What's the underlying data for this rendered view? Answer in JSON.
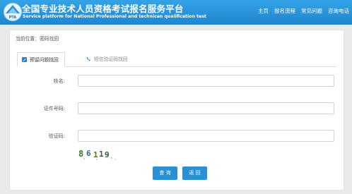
{
  "header": {
    "title": "全国专业技术人员资格考试报名服务平台",
    "subtitle": "Service platform for National Professional and technican qualification test",
    "nav": [
      "主页",
      "报名流程",
      "常见问题",
      "咨询电话"
    ]
  },
  "breadcrumb": "当前位置：密码找回",
  "tabs": [
    "预留问题找回",
    "短信验证码找回"
  ],
  "form": {
    "name_label": "姓名:",
    "id_label": "证件号码:",
    "captcha_label": "验证码:",
    "captcha_text": "86119"
  },
  "buttons": {
    "query": "查 询",
    "back": "返 回"
  },
  "colors": {
    "header": "#1f86cf",
    "button": "#2b8fd3"
  }
}
